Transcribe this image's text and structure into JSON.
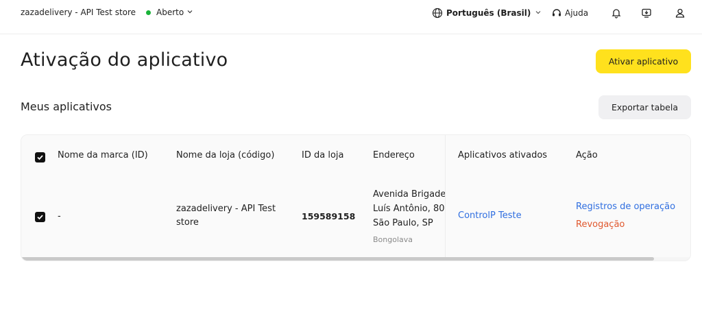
{
  "topbar": {
    "store_name": "zazadelivery - API Test store",
    "status": "Aberto",
    "language": "Português (Brasil)",
    "help": "Ajuda",
    "status_color": "#19b339",
    "icons": [
      "globe-icon",
      "headset-icon",
      "bell-icon",
      "download-icon",
      "user-icon"
    ]
  },
  "page": {
    "title": "Ativação do aplicativo",
    "activate_button": "Ativar aplicativo",
    "section_title": "Meus aplicativos",
    "export_button": "Exportar tabela",
    "accent_color": "#ffe11d"
  },
  "table": {
    "columns": [
      "Nome da marca (ID)",
      "Nome da loja (código)",
      "ID da loja",
      "Endereço",
      "Aplicativos ativados",
      "Ação"
    ],
    "rows": [
      {
        "checked": true,
        "brand": "-",
        "store_line1": "zazadelivery - API Test",
        "store_line2": "store",
        "store_id": "159589158",
        "address_line1": "Avenida Brigadeiro",
        "address_line2": "Luís Antônio, 80",
        "address_line3": "São Paulo, SP",
        "address_sub": "Bongolava",
        "app": "ControlP Teste",
        "action_logs": "Registros de operação",
        "action_revoke": "Revogação"
      }
    ],
    "header_checked": true
  }
}
